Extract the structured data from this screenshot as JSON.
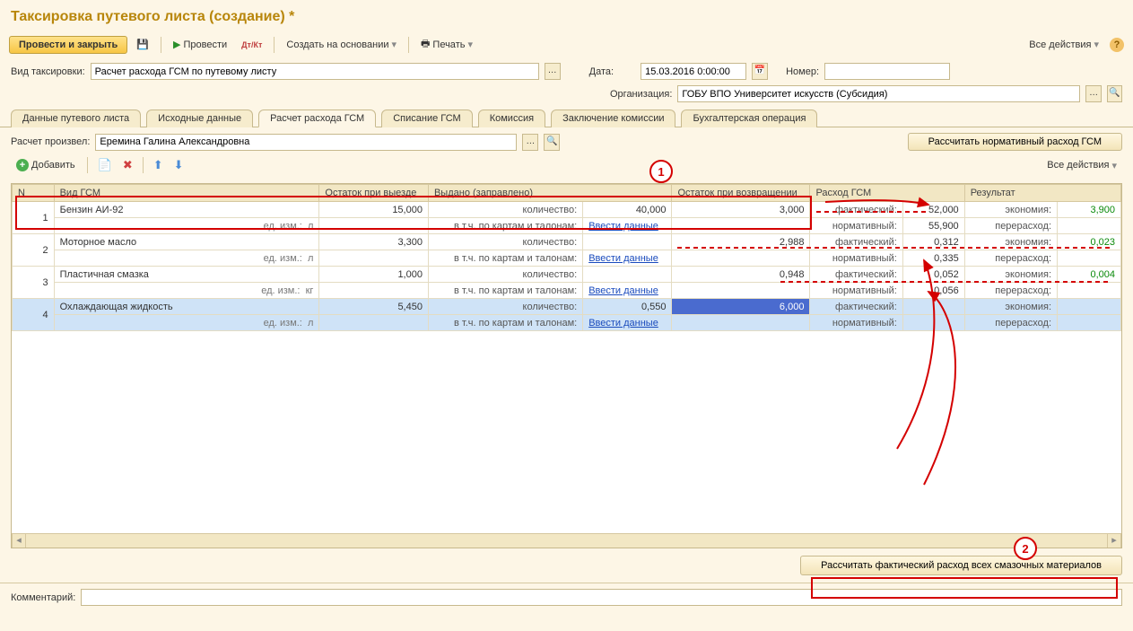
{
  "title": "Таксировка путевого листа (создание) *",
  "toolbar": {
    "post_close": "Провести и закрыть",
    "post": "Провести",
    "create_based": "Создать на основании",
    "print": "Печать",
    "all_actions": "Все действия"
  },
  "fields": {
    "tax_type_label": "Вид таксировки:",
    "tax_type_value": "Расчет расхода ГСМ по путевому листу",
    "date_label": "Дата:",
    "date_value": "15.03.2016 0:00:00",
    "number_label": "Номер:",
    "number_value": "",
    "org_label": "Организация:",
    "org_value": "ГОБУ ВПО Университет искусств (Субсидия)"
  },
  "tabs": [
    "Данные путевого листа",
    "Исходные данные",
    "Расчет расхода ГСМ",
    "Списание ГСМ",
    "Комиссия",
    "Заключение комиссии",
    "Бухгалтерская операция"
  ],
  "active_tab": 2,
  "calc": {
    "performer_label": "Расчет произвел:",
    "performer_value": "Еремина Галина Александровна",
    "calc_norm_btn": "Рассчитать нормативный расход ГСМ",
    "add_btn": "Добавить",
    "all_actions": "Все действия"
  },
  "cols": {
    "n": "N",
    "type": "Вид ГСМ",
    "balance_out": "Остаток при выезде",
    "issued": "Выдано (заправлено)",
    "balance_back": "Остаток при возвращении",
    "consumption": "Расход ГСМ",
    "result": "Результат"
  },
  "sublabels": {
    "unit_prefix": "ед. изм.:",
    "qty": "количество:",
    "by_cards": "в т.ч. по картам и талонам:",
    "enter_data": "Ввести данные",
    "fact": "фактический:",
    "norm": "нормативный:",
    "economy": "экономия:",
    "overrun": "перерасход:"
  },
  "rows": [
    {
      "n": 1,
      "name": "Бензин АИ-92",
      "unit": "л",
      "balance_out": "15,000",
      "qty": "40,000",
      "balance_back": "3,000",
      "fact": "52,000",
      "norm": "55,900",
      "economy": "3,900",
      "overrun": ""
    },
    {
      "n": 2,
      "name": "Моторное масло",
      "unit": "л",
      "balance_out": "3,300",
      "qty": "",
      "balance_back": "2,988",
      "fact": "0,312",
      "norm": "0,335",
      "economy": "0,023",
      "overrun": ""
    },
    {
      "n": 3,
      "name": "Пластичная смазка",
      "unit": "кг",
      "balance_out": "1,000",
      "qty": "",
      "balance_back": "0,948",
      "fact": "0,052",
      "norm": "0,056",
      "economy": "0,004",
      "overrun": ""
    },
    {
      "n": 4,
      "name": "Охлаждающая жидкость",
      "unit": "л",
      "balance_out": "5,450",
      "qty": "0,550",
      "balance_back": "6,000",
      "fact": "",
      "norm": "",
      "economy": "",
      "overrun": ""
    }
  ],
  "bottom_btn": "Рассчитать фактический расход всех смазочных материалов",
  "comment_label": "Комментарий:",
  "comment_value": "",
  "annotations": {
    "marker1": "1",
    "marker2": "2"
  }
}
